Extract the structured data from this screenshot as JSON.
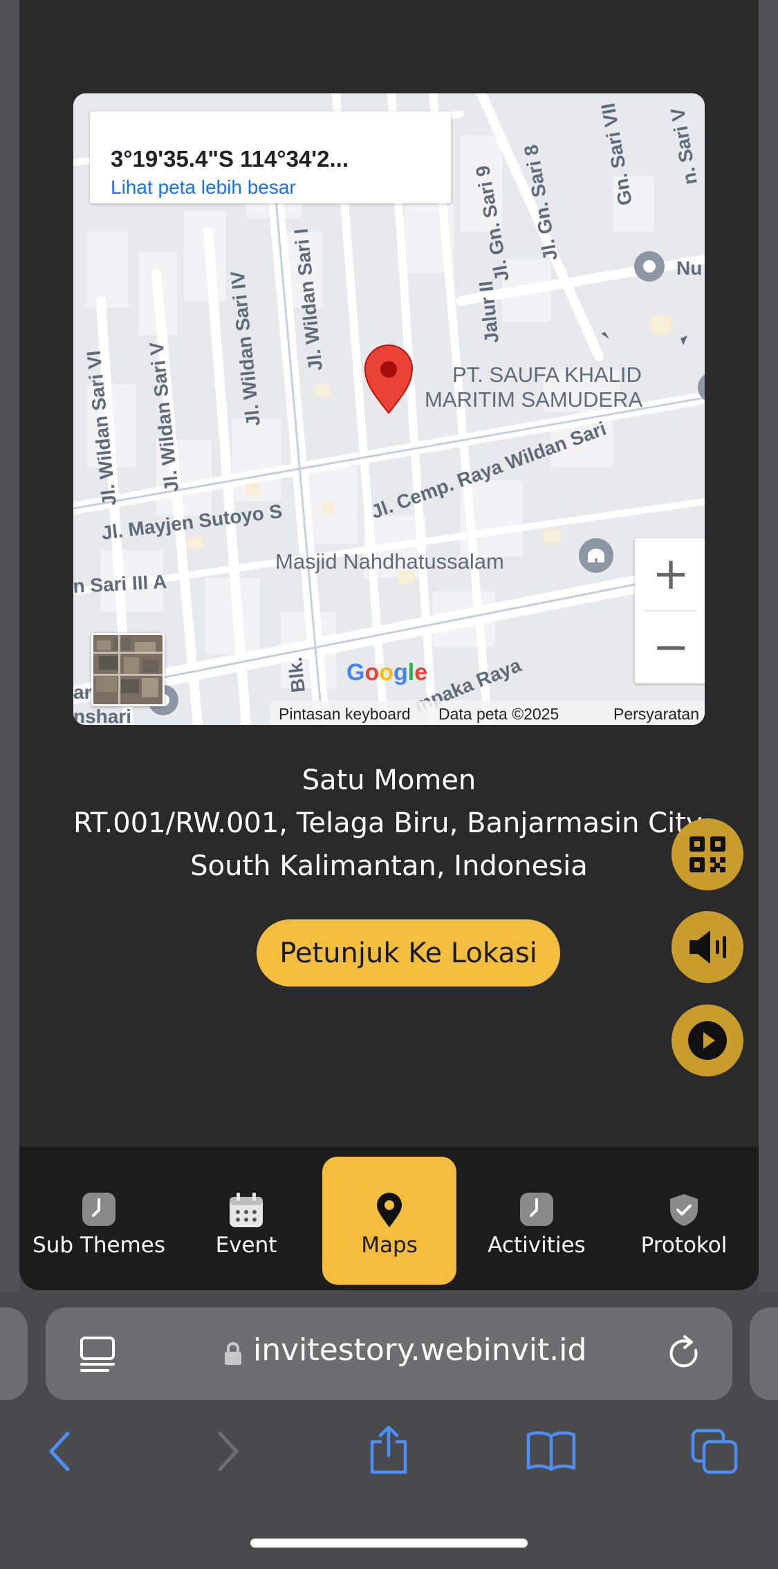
{
  "map": {
    "coords": "3°19'35.4\"S 114°34'2...",
    "larger_map_link": "Lihat peta lebih besar",
    "street_labels": [
      "Jl. Wildan Sari I",
      "Jl. Wildan Sari IV",
      "Jl. Wildan Sari V",
      "Jl. Wildan Sari VI",
      "Jl. Gn. Sari 9",
      "Jl. Gn. Sari 8",
      "Gn. Sari VII",
      "n. Sari V",
      "Jalur II",
      "Jl. Cemp. Raya Wildan Sari",
      "Jl. Mayjen Sutoyo S",
      "n Sari III A",
      "mpaka Raya",
      "Blk.",
      "an",
      "nshari",
      "Nu"
    ],
    "place_label_line1": "PT. SAUFA KHALID",
    "place_label_line2": "MARITIM SAMUDERA",
    "mosque_label": "Masjid Nahdhatussalam",
    "zoom_in": "+",
    "zoom_out": "−",
    "logo": "Google",
    "footer": {
      "shortcuts": "Pintasan keyboard",
      "data": "Data peta ©2025",
      "terms": "Persyaratan"
    }
  },
  "venue": {
    "name": "Satu Momen",
    "address_line1": "RT.001/RW.001, Telaga Biru, Banjarmasin City,",
    "address_line2": "South Kalimantan, Indonesia"
  },
  "directions_button": "Petunjuk Ke Lokasi",
  "fabs": [
    "qr-code-icon",
    "speaker-icon",
    "play-icon"
  ],
  "nav": {
    "items": [
      {
        "label": "Sub Themes",
        "icon": "clock-icon"
      },
      {
        "label": "Event",
        "icon": "calendar-icon"
      },
      {
        "label": "Maps",
        "icon": "map-pin-icon",
        "active": true
      },
      {
        "label": "Activities",
        "icon": "clock-icon"
      },
      {
        "label": "Protokol",
        "icon": "shield-check-icon"
      }
    ]
  },
  "browser": {
    "url": "invitestory.webinvit.id"
  },
  "colors": {
    "accent": "#f4bd3e",
    "fab": "#c99d2b",
    "card_bg": "#2a2a2a",
    "nav_bg": "#1c1c1c",
    "ios_blue": "#4c8ff7"
  }
}
